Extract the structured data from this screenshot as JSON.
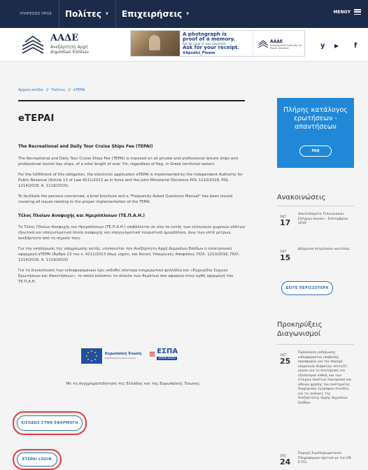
{
  "topnav": {
    "services": "ΥΠΗΡΕΣΙΕΣ ΠΡΟΣ",
    "item1": "Πολίτες",
    "item2": "Επιχειρήσεις",
    "menu": "ΜΕΝΟΥ"
  },
  "header": {
    "logo_title": "ΑΑΔΕ",
    "logo_sub": "Ανεξάρτητη Αρχή Δημοσίων Εσόδων",
    "banner": {
      "line1": "A photograph is proof of a memory.",
      "line2": "Ask for proof of your payments.",
      "line3": "Ask for your receipt.",
      "line4": "#Apodixi_Please",
      "brand": "ΑΑΔΕ",
      "brand_sub": "Independent Authority for Public Revenue"
    },
    "social": [
      "y",
      "▶",
      "f"
    ]
  },
  "breadcrumb": [
    "Αρχική σελίδα",
    "Πολίτες",
    "eTEPAI"
  ],
  "page": {
    "title": "eTEPAI",
    "en_heading": "The Recreational and Daily Tour Cruise Ships Fee (TEPAI)",
    "en_p1": "The Recreational and Daily Tour Cruise Ships Fee (TEPAI) is imposed on all private and professional leisure ships and professional tourist day ships, of a total length of over 7m, regardless of flag, in Greek territorial waters.",
    "en_p2": "For the fulfillment of this obligation, the electronic application eTEPAI is implemented by the Independent Authority for Public Revenue (Article 13 of Law 4211/2013 as in force and the joint Ministerial Decisions POL 1210/2018, POL 1214/2018, A. 1119/2019).",
    "en_p3": "To facilitate the persons concerned, a brief brochure and a \"Frequently Asked Questions Manual\" has been issued covering all issues relating to the proper implementation of the TEPAI.",
    "gr_heading": "Τέλος Πλοίων Αναψυχής και Ημερόπλοιων (ΤΕ.Π.Α.Η.)",
    "gr_p1": "Το Τέλος Πλοίων Αναψυχής και Ημερόπλοιων (ΤΕ.Π.Α.Η.) επιβάλλεται σε όλα τα εντός των ελληνικών χωρικών υδάτων ιδιωτικά και επαγγελματικά πλοία αναψυχής και επαγγελματικά τουριστικά ημερόπλοια, άνω των επτά μέτρων, ανεξάρτητα από τη σημαία τους.",
    "gr_p2": "Για την εκπλήρωση της υποχρέωσης αυτής, υλοποιείται την Ανεξάρτητη Αρχή Δημοσίων Εσόδων η ηλεκτρονική εφαρμογή eTEPAI (Άρθρο 13 του ν. 4211/2013 όπως ισχύει, και Κοινές Υπουργικές Αποφάσεις ΠΟΛ. 1210/2018, ΠΟΛ. 1214/2018, Α. 1119/2019)",
    "gr_p3": "Για τη διευκόλυνση των ενδιαφερομένων έχει εκδοθεί σύντομο ενημερωτικό φυλλάδιο και «Εγχειρίδιο Συχνών Ερωτήσεων και Απαντήσεων», το οποίο καλύπτει το σύνολο των θεμάτων που αφορούν στην ορθή εφαρμογή του ΤΕ.Π.Α.Η.",
    "eu_label": "Ευρωπαϊκή Ένωση",
    "eu_small": "Ευρωπαϊκό Κοινωνικό Ταμείο",
    "espa": "ΕΣΠΑ",
    "espa_years": "2014-2020",
    "cofund": "Με τη συγχρηματοδότηση της Ελλάδας και της Ευρωπαϊκής Ένωσης",
    "btn_enter": "ΕΙΣΟΔΟΣ ΣΤΗΝ ΕΦΑΡΜΟΓΗ",
    "btn_login": "ETEPAI LOGIN"
  },
  "sidebar": {
    "faq_title": "Πλήρης κατάλογος ερωτήσεων - απαντήσεων",
    "faq_button": "FAQ",
    "announcements_title": "Ανακοινώσεις",
    "announcements": [
      {
        "mon": "ΟΚΤ",
        "day": "17",
        "text": "Αποτελέσματα Τελωνειακών Ελέγχων Ιουνίου - Σεπτεμβρίου 2019"
      },
      {
        "mon": "ΟΚΤ",
        "day": "15",
        "text": "Δέσμευση πετρελαίου ναυτιλίας"
      }
    ],
    "see_more": "ΔΕΙΤΕ ΠΕΡΙΣΣΟΤΕΡΑ",
    "tenders_title": "Προκηρύξεις Διαγωνισμοί",
    "tenders": [
      {
        "mon": "ΟΚΤ",
        "day": "25",
        "text": "Πρόσκληση εκδήλωσης ενδιαφέροντος υποβολής προσφορών για την παροχή υπηρεσιών διάρκειας πέντε(5) μηνών για τη συντήρηση του εξοπλισμού καθώς και των έτοιμων πακέτων λογισμικού και αδειών χρήσης του συστήματος διαχείρισης εγγράφων (Invelix), για τις ανάγκες της Ανεξάρτητης Αρχής Δημοσίων Εσόδων"
      },
      {
        "mon": "ΟΚΤ",
        "day": "24",
        "text": "Παροχή Συμπληρωματικών Πληροφοριών σχετικά με την Οδ. Ε.Π.Ε."
      }
    ]
  }
}
